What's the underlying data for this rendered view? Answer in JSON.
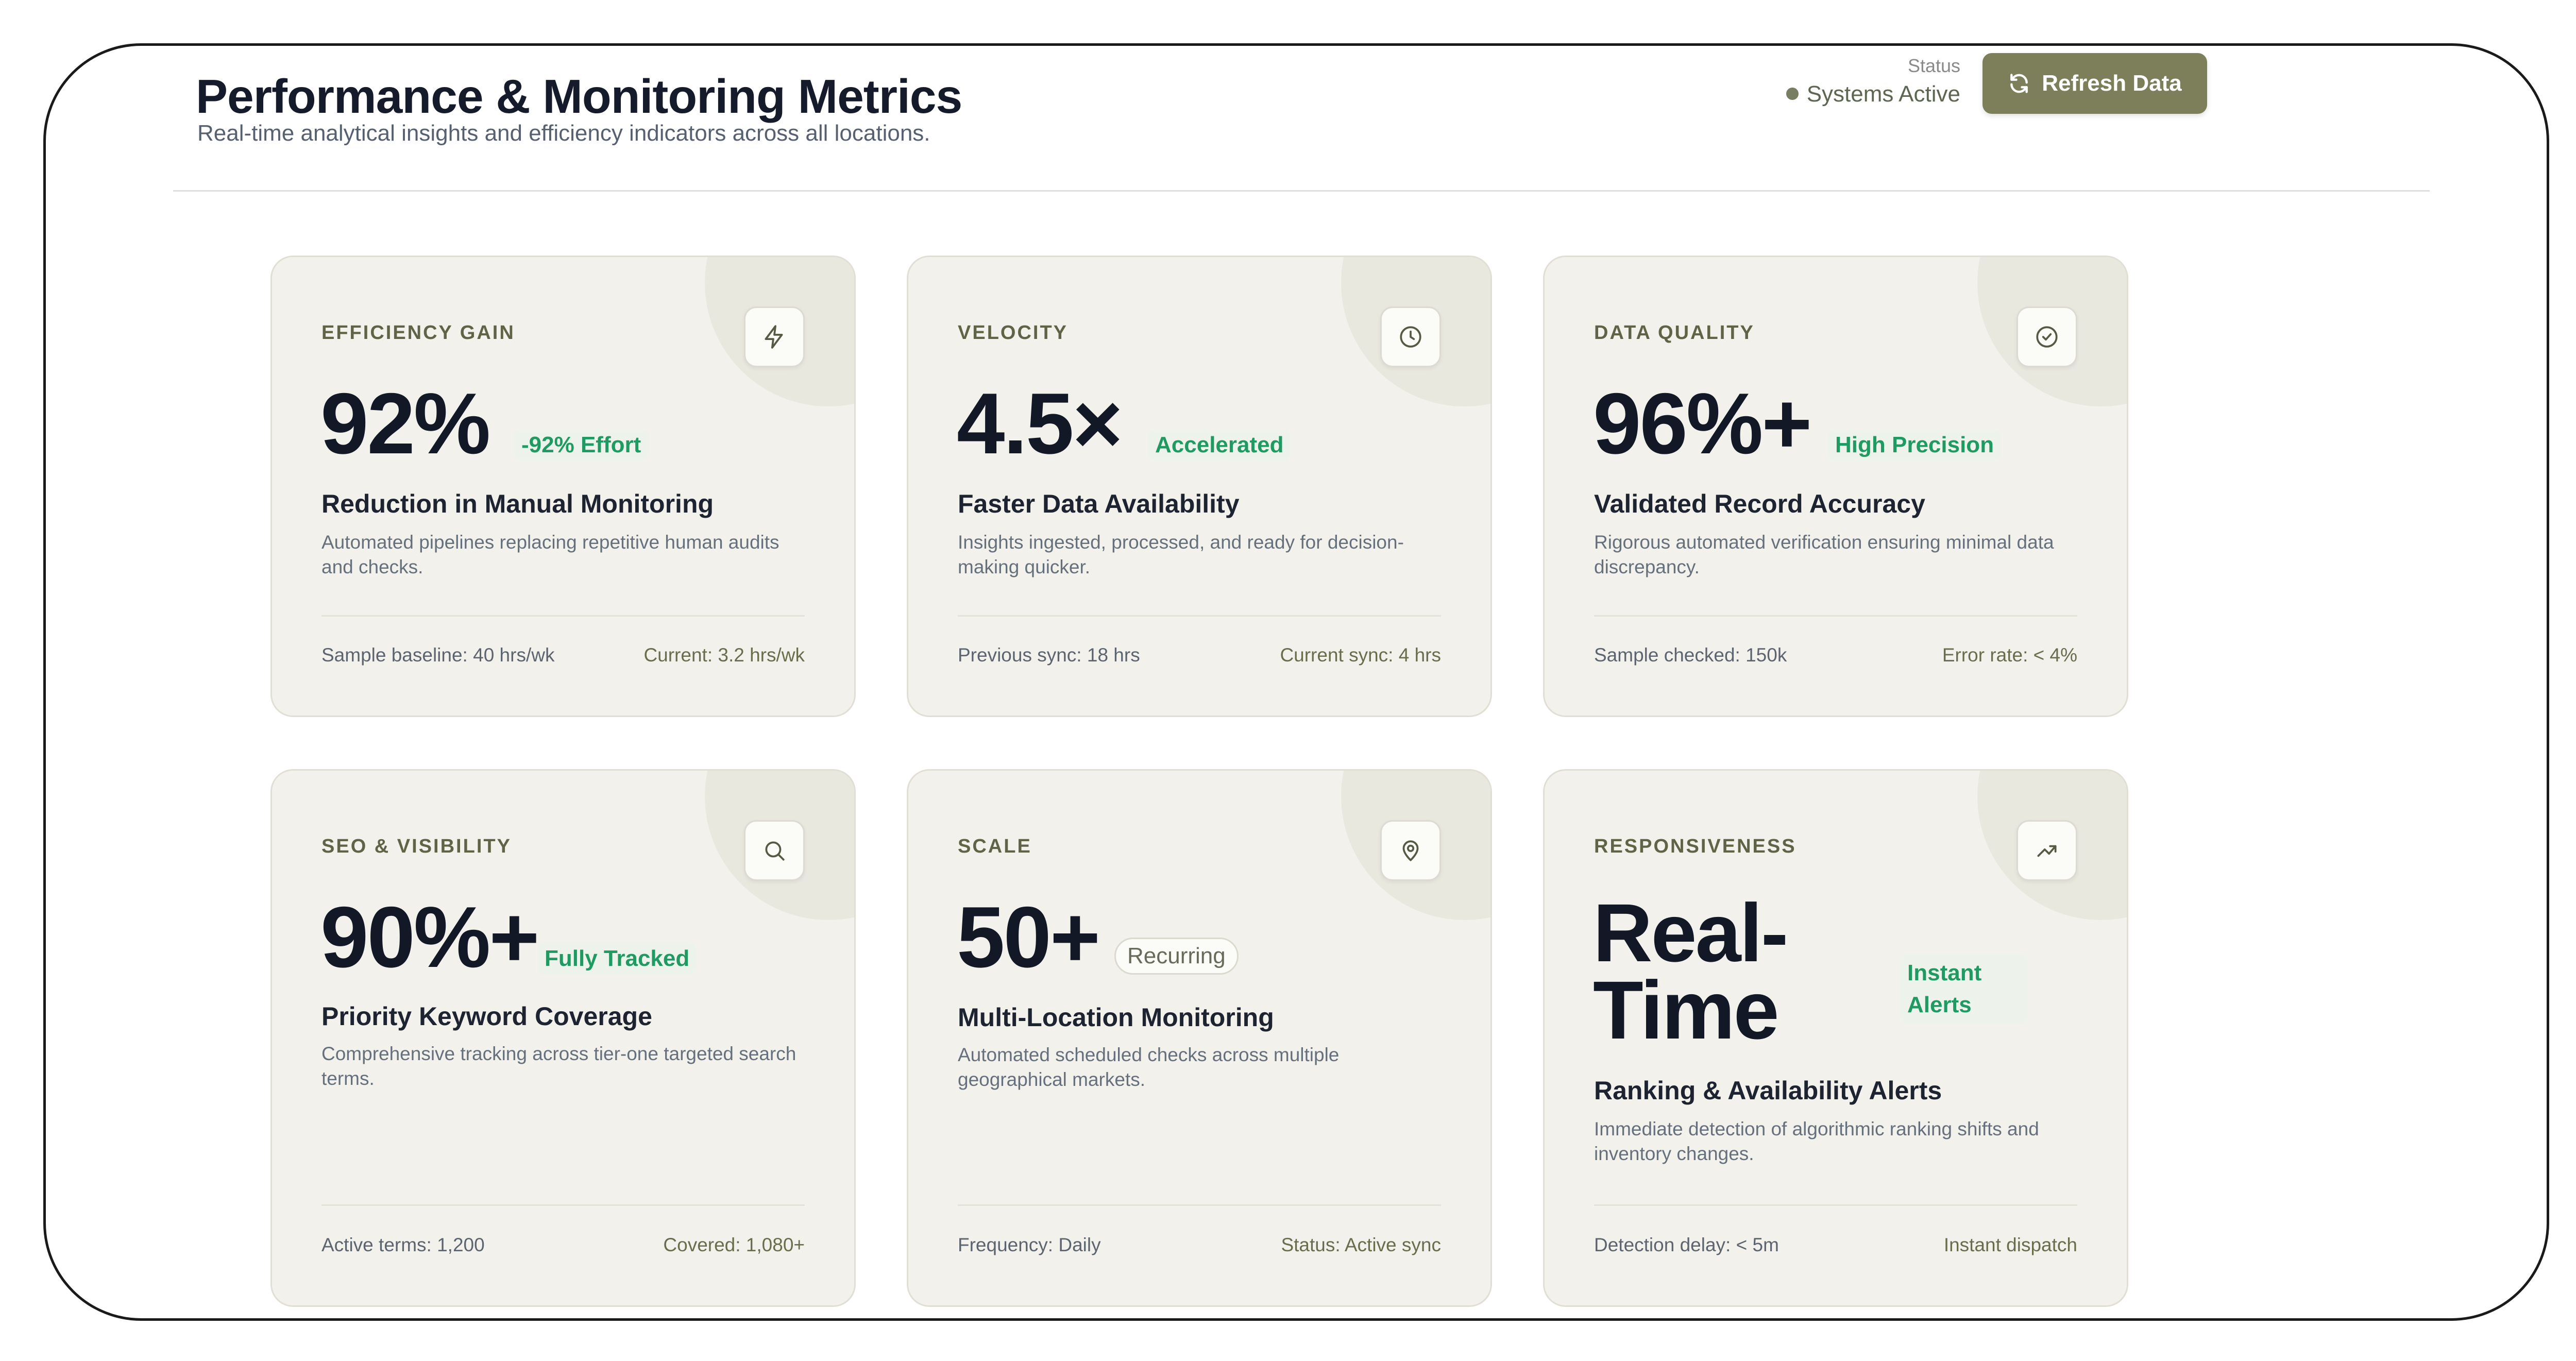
{
  "header": {
    "title": "Performance & Monitoring Metrics",
    "subtitle": "Real-time analytical insights and efficiency indicators across all locations.",
    "status_label": "Status",
    "status_value": "Systems Active",
    "refresh_label": "Refresh Data"
  },
  "cards": [
    {
      "label": "EFFICIENCY GAIN",
      "icon": "lightning-icon",
      "value": "92%",
      "badge": "-92% Effort",
      "title": "Reduction in Manual Monitoring",
      "description": "Automated pipelines replacing repetitive human audits and checks.",
      "footer_left": "Sample baseline: 40 hrs/wk",
      "footer_right": "Current: 3.2 hrs/wk"
    },
    {
      "label": "VELOCITY",
      "icon": "clock-icon",
      "value": "4.5×",
      "badge": "Accelerated",
      "title": "Faster Data Availability",
      "description": "Insights ingested, processed, and ready for decision-making quicker.",
      "footer_left": "Previous sync: 18 hrs",
      "footer_right": "Current sync: 4 hrs"
    },
    {
      "label": "DATA QUALITY",
      "icon": "check-circle-icon",
      "value": "96%+",
      "badge": "High Precision",
      "title": "Validated Record Accuracy",
      "description": "Rigorous automated verification ensuring minimal data discrepancy.",
      "footer_left": "Sample checked: 150k",
      "footer_right": "Error rate: < 4%"
    },
    {
      "label": "SEO & VISIBILITY",
      "icon": "search-icon",
      "value": "90%+",
      "badge": "Fully Tracked",
      "title": "Priority Keyword Coverage",
      "description": "Comprehensive tracking across tier-one targeted search terms.",
      "footer_left": "Active terms: 1,200",
      "footer_right": "Covered: 1,080+"
    },
    {
      "label": "SCALE",
      "icon": "location-pin-icon",
      "value": "50+",
      "badge": "Recurring",
      "title": "Multi-Location Monitoring",
      "description": "Automated scheduled checks across multiple geographical markets.",
      "footer_left": "Frequency: Daily",
      "footer_right": "Status: Active sync"
    },
    {
      "label": "RESPONSIVENESS",
      "icon": "trending-up-icon",
      "value": "Real-Time",
      "badge": "Instant Alerts",
      "title": "Ranking & Availability Alerts",
      "description": "Immediate detection of algorithmic ranking shifts and inventory changes.",
      "footer_left": "Detection delay: < 5m",
      "footer_right": "Instant dispatch"
    }
  ]
}
